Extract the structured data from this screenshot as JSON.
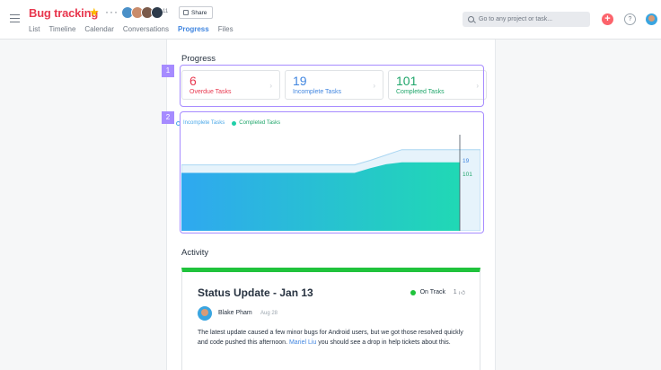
{
  "header": {
    "project_title": "Bug tracking",
    "more_label": "···",
    "member_count": "11",
    "share_label": "Share",
    "tabs": [
      {
        "label": "List",
        "active": false
      },
      {
        "label": "Timeline",
        "active": false
      },
      {
        "label": "Calendar",
        "active": false
      },
      {
        "label": "Conversations",
        "active": false
      },
      {
        "label": "Progress",
        "active": true
      },
      {
        "label": "Files",
        "active": false
      }
    ],
    "search_placeholder": "Go to any project or task...",
    "plus_label": "+",
    "help_label": "?"
  },
  "progress": {
    "title": "Progress",
    "callouts": [
      "1",
      "2"
    ],
    "stats": [
      {
        "value": "6",
        "label": "Overdue Tasks",
        "color": "#e8384f"
      },
      {
        "value": "19",
        "label": "Incomplete Tasks",
        "color": "#4186e0"
      },
      {
        "value": "101",
        "label": "Completed Tasks",
        "color": "#20a66b"
      }
    ],
    "legend": [
      {
        "label": "Incomplete Tasks",
        "color": "#4aa8e8"
      },
      {
        "label": "Completed Tasks",
        "color": "#1fcfa8"
      }
    ]
  },
  "chart_data": {
    "type": "area",
    "series": [
      {
        "name": "Incomplete Tasks",
        "values": [
          97,
          97,
          97,
          97,
          97,
          97,
          97,
          97,
          97,
          97,
          97,
          97,
          104,
          112,
          120,
          120,
          120,
          120,
          120,
          120
        ]
      },
      {
        "name": "Completed Tasks",
        "values": [
          85,
          85,
          85,
          85,
          85,
          85,
          85,
          85,
          85,
          85,
          85,
          85,
          92,
          98,
          101,
          101,
          101,
          101,
          101,
          101
        ]
      }
    ],
    "end_labels": [
      "19",
      "101"
    ],
    "ylim": [
      0,
      140
    ],
    "grid": false,
    "legend_placement": "top-left"
  },
  "activity": {
    "title": "Activity",
    "status_title": "Status Update - Jan 13",
    "status": "On Track",
    "like_count": "1",
    "author": "Blake Pham",
    "date": "Aug 28",
    "body_before": "The latest update caused a few minor bugs for Android users, but we got those resolved quickly and code pushed this afternoon. ",
    "mention": "Mariel Liu",
    "body_after": " you should see a drop in help tickets about this."
  }
}
